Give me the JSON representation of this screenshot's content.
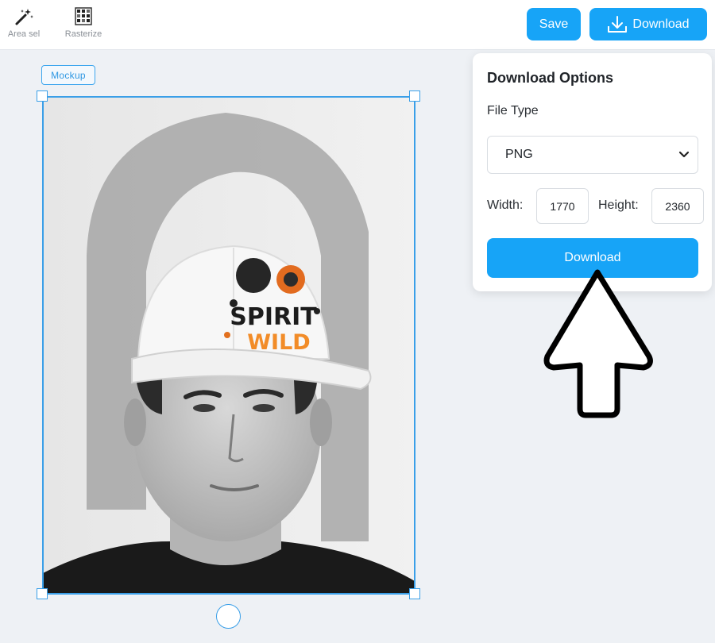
{
  "toolbar": {
    "tools": [
      {
        "label": "Area sel",
        "icon": "magic-wand-icon"
      },
      {
        "label": "Rasterize",
        "icon": "rasterize-grid-icon"
      }
    ],
    "save_label": "Save",
    "download_label": "Download",
    "download_icon": "download-tray-icon"
  },
  "canvas": {
    "layer_tag": "Mockup",
    "cap_print": {
      "line1": "SPIRIT",
      "line2": "WILD"
    }
  },
  "download_panel": {
    "title": "Download Options",
    "file_type_label": "File Type",
    "file_type_value": "PNG",
    "width_label": "Width:",
    "width_value": "1770",
    "height_label": "Height:",
    "height_value": "2360",
    "download_button": "Download"
  },
  "colors": {
    "accent": "#17a4f7",
    "selection": "#3a9fe8",
    "background": "#eef1f5"
  }
}
